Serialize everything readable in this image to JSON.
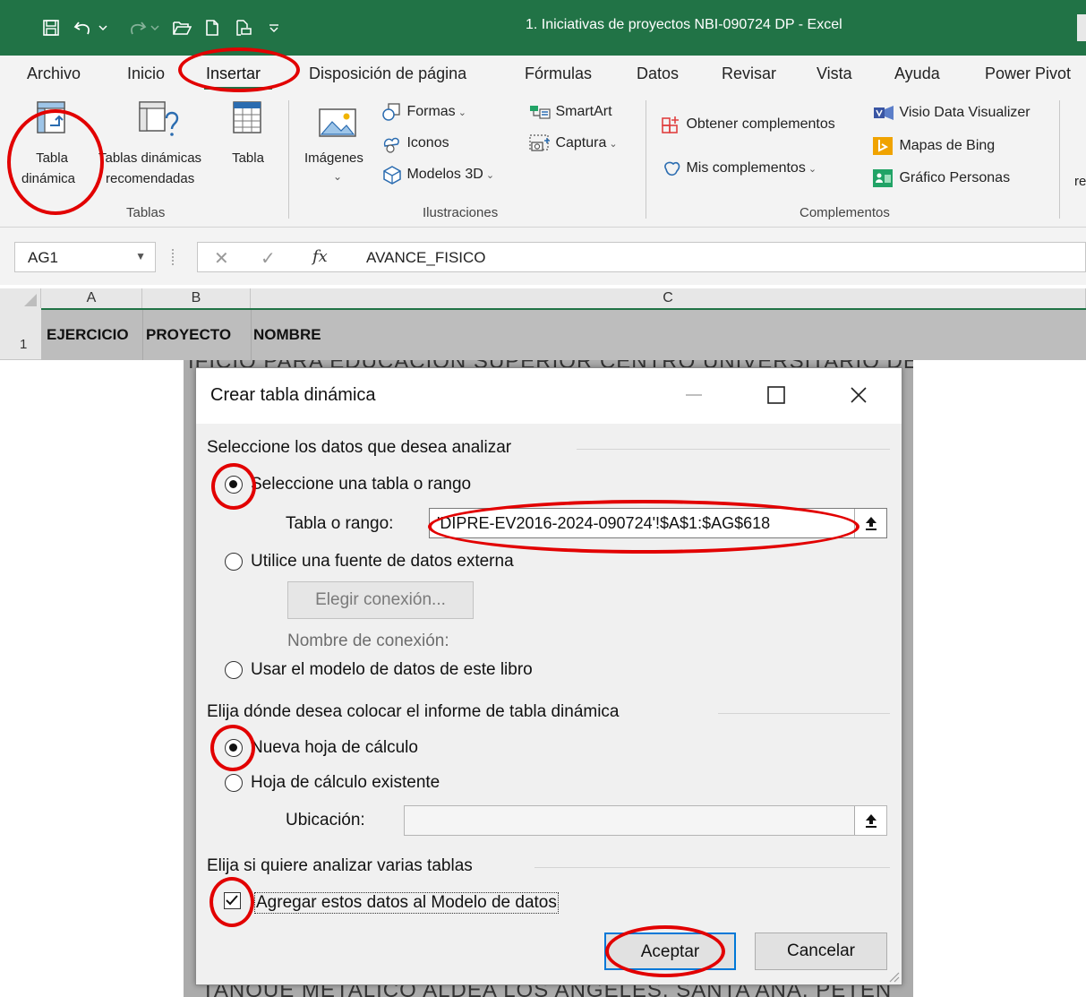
{
  "window": {
    "title": "1. Iniciativas de proyectos NBI-090724 DP  -  Excel",
    "brand_color": "#217346",
    "quick_access": [
      "save-icon",
      "undo-icon",
      "redo-icon",
      "open-icon",
      "new-icon",
      "print-preview-icon",
      "customize-icon"
    ]
  },
  "tabs": [
    {
      "label": "Archivo"
    },
    {
      "label": "Inicio"
    },
    {
      "label": "Insertar",
      "active": true
    },
    {
      "label": "Disposición de página"
    },
    {
      "label": "Fórmulas"
    },
    {
      "label": "Datos"
    },
    {
      "label": "Revisar"
    },
    {
      "label": "Vista"
    },
    {
      "label": "Ayuda"
    },
    {
      "label": "Power Pivot"
    }
  ],
  "ribbon": {
    "tablas": {
      "pivot_line1": "Tabla",
      "pivot_line2": "dinámica",
      "recommended_line1": "Tablas dinámicas",
      "recommended_line2": "recomendadas",
      "table": "Tabla",
      "group_label": "Tablas"
    },
    "ilustraciones": {
      "images": "Imágenes",
      "shapes": "Formas",
      "icons": "Iconos",
      "models3d": "Modelos 3D",
      "smartart": "SmartArt",
      "capture": "Captura",
      "group_label": "Ilustraciones"
    },
    "complementos": {
      "get_addins": "Obtener complementos",
      "my_addins": "Mis complementos",
      "visio": "Visio Data Visualizer",
      "bing": "Mapas de Bing",
      "people": "Gráfico Personas",
      "group_label": "Complementos",
      "cut_label": "re"
    }
  },
  "formula_bar": {
    "name_box": "AG1",
    "fx": "fx",
    "formula": "AVANCE_FISICO"
  },
  "sheet": {
    "columns": [
      "A",
      "B",
      "C"
    ],
    "row_number": "1",
    "row1": [
      "EJERCICIO",
      "PROYECTO",
      "NOMBRE"
    ],
    "partial_text_top": "IFICIO PARA EDUCACION SUPERIOR CENTRO UNIVERSITARIO DE",
    "partial_text_bottom": "TANQUE METALICO ALDEA LOS ANGELES, SANTA ANA, PETEN"
  },
  "dialog": {
    "title": "Crear tabla dinámica",
    "section_data": "Seleccione los datos que desea analizar",
    "opt_table_range": "Seleccione una tabla o rango",
    "table_range_label": "Tabla o rango:",
    "table_range_value": "'DIPRE-EV2016-2024-090724'!$A$1:$AG$618",
    "opt_external": "Utilice una fuente de datos externa",
    "choose_connection": "Elegir conexión...",
    "connection_name_label": "Nombre de conexión:",
    "opt_data_model": "Usar el modelo de datos de este libro",
    "section_place": "Elija dónde desea colocar el informe de tabla dinámica",
    "opt_new_sheet": "Nueva hoja de cálculo",
    "opt_existing_sheet": "Hoja de cálculo existente",
    "location_label": "Ubicación:",
    "location_value": "",
    "section_multi": "Elija si quiere analizar varias tablas",
    "add_to_model": "Agregar estos datos al Modelo de datos",
    "add_to_model_checked": true,
    "ok": "Aceptar",
    "cancel": "Cancelar"
  },
  "annotation_color": "#e20000"
}
